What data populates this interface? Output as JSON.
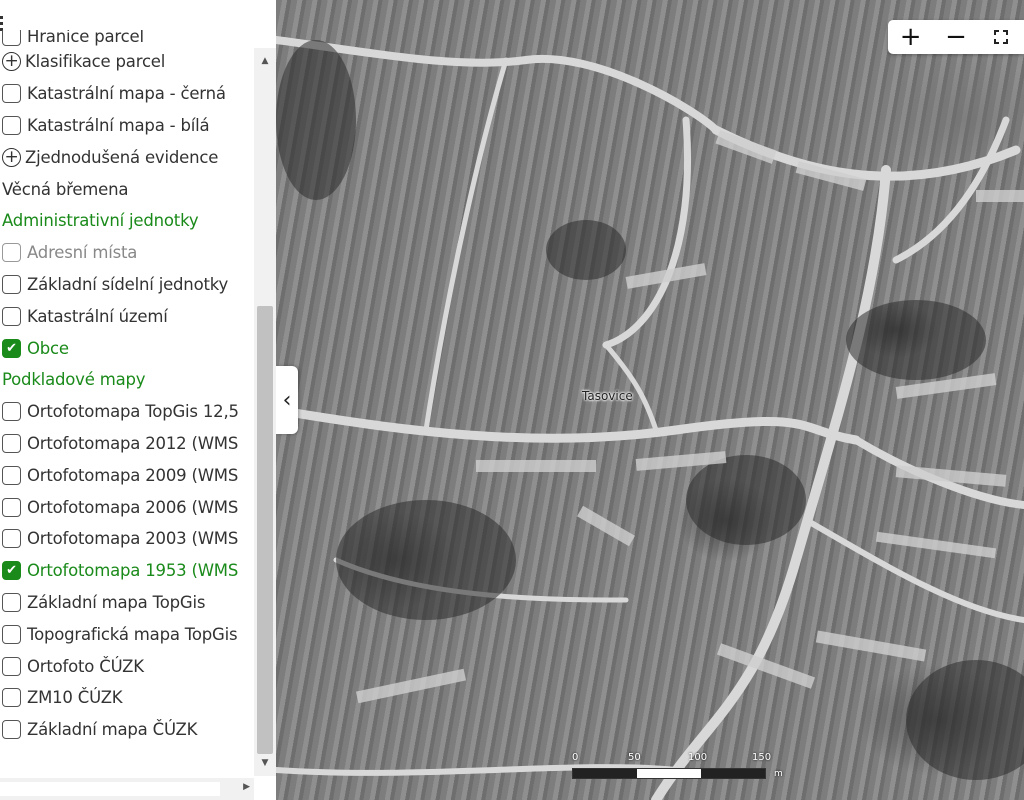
{
  "panel": {
    "layers": [
      {
        "kind": "checkbox",
        "label": "Hranice parcel",
        "checked": false,
        "clipped": true
      },
      {
        "kind": "expand",
        "label": "Klasifikace parcel"
      },
      {
        "kind": "checkbox",
        "label": "Katastrální mapa - černá",
        "checked": false
      },
      {
        "kind": "checkbox",
        "label": "Katastrální mapa - bílá",
        "checked": false
      },
      {
        "kind": "expand",
        "label": "Zjednodušená evidence"
      },
      {
        "kind": "text",
        "label": "Věcná břemena"
      },
      {
        "kind": "group",
        "label": "Administrativní jednotky"
      },
      {
        "kind": "checkbox",
        "label": "Adresní místa",
        "checked": false,
        "disabled": true
      },
      {
        "kind": "checkbox",
        "label": "Základní sídelní jednotky",
        "checked": false
      },
      {
        "kind": "checkbox",
        "label": "Katastrální území",
        "checked": false
      },
      {
        "kind": "checkbox",
        "label": "Obce",
        "checked": true
      },
      {
        "kind": "group",
        "label": "Podkladové mapy"
      },
      {
        "kind": "checkbox",
        "label": "Ortofotomapa TopGis 12,5",
        "checked": false
      },
      {
        "kind": "checkbox",
        "label": "Ortofotomapa 2012 (WMS",
        "checked": false
      },
      {
        "kind": "checkbox",
        "label": "Ortofotomapa 2009 (WMS",
        "checked": false
      },
      {
        "kind": "checkbox",
        "label": "Ortofotomapa 2006 (WMS",
        "checked": false
      },
      {
        "kind": "checkbox",
        "label": "Ortofotomapa 2003 (WMS",
        "checked": false
      },
      {
        "kind": "checkbox",
        "label": "Ortofotomapa 1953 (WMS",
        "checked": true
      },
      {
        "kind": "checkbox",
        "label": "Základní mapa TopGis",
        "checked": false
      },
      {
        "kind": "checkbox",
        "label": "Topografická mapa TopGis",
        "checked": false
      },
      {
        "kind": "checkbox",
        "label": "Ortofoto ČÚZK",
        "checked": false
      },
      {
        "kind": "checkbox",
        "label": "ZM10 ČÚZK",
        "checked": false
      },
      {
        "kind": "checkbox",
        "label": "Základní mapa ČÚZK",
        "checked": false
      }
    ]
  },
  "map": {
    "place_label": "Tasovice",
    "zoom_in": "+",
    "zoom_out": "−",
    "collapse_glyph": "‹",
    "scale": {
      "ticks": [
        "0",
        "50",
        "100",
        "150"
      ],
      "unit": "m"
    }
  },
  "colors": {
    "accent": "#1a8a1a"
  }
}
